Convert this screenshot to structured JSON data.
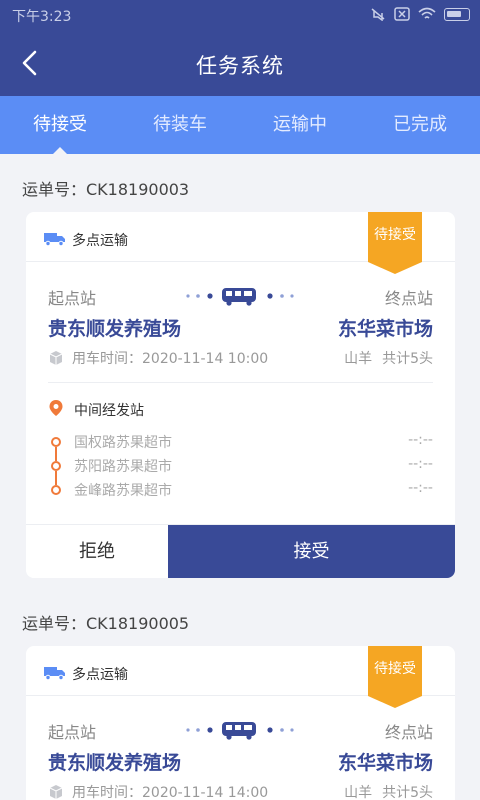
{
  "status_bar": {
    "time": "下午3:23"
  },
  "header": {
    "title": "任务系统"
  },
  "tabs": [
    {
      "label": "待接受",
      "active": true
    },
    {
      "label": "待装车",
      "active": false
    },
    {
      "label": "运输中",
      "active": false
    },
    {
      "label": "已完成",
      "active": false
    }
  ],
  "colors": {
    "primary": "#394a97",
    "tab_bar": "#5b8df5",
    "ribbon": "#f5a623",
    "stop_line": "#f07a3a"
  },
  "orders": [
    {
      "waybill": "运单号：CK18190003",
      "type": "多点运输",
      "status": "待接受",
      "origin_label": "起点站",
      "origin": "贵东顺发养殖场",
      "destination_label": "终点站",
      "destination": "东华菜市场",
      "use_time": "用车时间：2020-11-14 10:00",
      "animal": "山羊",
      "count": "共计5头",
      "mid_title": "中间经发站",
      "stops": [
        {
          "name": "国权路苏果超市",
          "time": "--:--"
        },
        {
          "name": "苏阳路苏果超市",
          "time": "--:--"
        },
        {
          "name": "金峰路苏果超市",
          "time": "--:--"
        }
      ],
      "reject_label": "拒绝",
      "accept_label": "接受"
    },
    {
      "waybill": "运单号：CK18190005",
      "type": "多点运输",
      "status": "待接受",
      "origin_label": "起点站",
      "origin": "贵东顺发养殖场",
      "destination_label": "终点站",
      "destination": "东华菜市场",
      "use_time": "用车时间：2020-11-14 14:00",
      "animal": "山羊",
      "count": "共计5头"
    }
  ]
}
